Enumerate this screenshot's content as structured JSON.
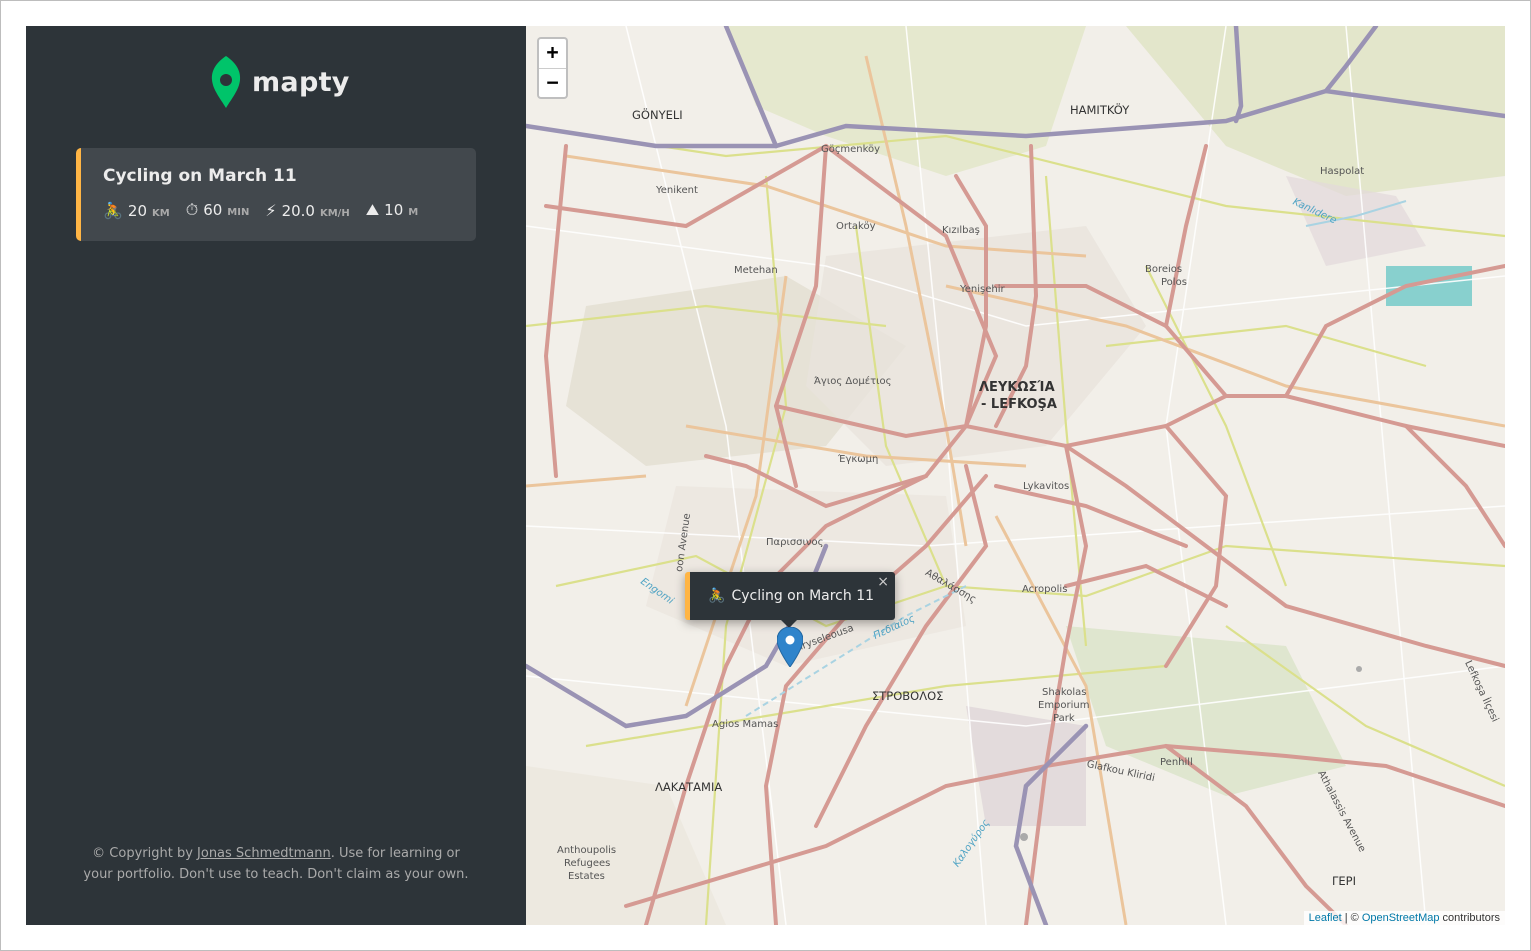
{
  "app": {
    "logo_text": "mapty",
    "copyright": {
      "prefix": "© Copyright by ",
      "author": "Jonas Schmedtmann",
      "suffix": ". Use for learning or your portfolio. Don't use to teach. Don't claim as your own."
    }
  },
  "workout": {
    "title": "Cycling on March 11",
    "type": "cycling",
    "accent": "#ffb545",
    "stats": [
      {
        "icon": "bicycle-icon",
        "glyph": "🚴",
        "value": "20",
        "unit": "km"
      },
      {
        "icon": "stopwatch-icon",
        "glyph": "⏱",
        "value": "60",
        "unit": "min"
      },
      {
        "icon": "lightning-icon",
        "glyph": "⚡",
        "value": "20.0",
        "unit": "km/h"
      },
      {
        "icon": "mountain-icon",
        "glyph": "⛰",
        "value": "10",
        "unit": "m"
      }
    ]
  },
  "map": {
    "zoom_in": "+",
    "zoom_out": "−",
    "popup": {
      "glyph": "🚴",
      "title": "Cycling on March 11",
      "close": "×"
    },
    "attribution": {
      "leaflet": "Leaflet",
      "sep": " | © ",
      "osm": "OpenStreetMap",
      "suffix": " contributors"
    },
    "labels": {
      "gonyeli": "GÖNYELI",
      "hamitkoy": "HAMITKÖY",
      "gocmenkoy": "Göçmenköy",
      "haspolat": "Haspolat",
      "kanlidere": "Kanlıdere",
      "yenikent": "Yenikent",
      "ortakoy": "Ortaköy",
      "kizilbas": "Kızılbaş",
      "metehan": "Metehan",
      "yenisehir": "Yenişehir",
      "boreios": "Boreios",
      "polos": "Polos",
      "agios_dometios": "Άγιος Δομέτιος",
      "lefkosia": "ΛΕΥΚΩΣΊΑ",
      "lefkosa": "- LEFKOŞA",
      "egkomi": "Έγκωμη",
      "lykavitos": "Lykavitos",
      "parisinos": "Παρισσινος",
      "avenue": "oon Avenue",
      "engomi": "Engomi",
      "athalassis": "Αθαλάσσης",
      "acropolis": "Acropolis",
      "chryseleousa": "Chryseleousa",
      "pediaios": "Πεδιαίος",
      "strovolos": "ΣΤΡΟΒΟΛΟΣ",
      "shakolas": "Shakolas",
      "emporium": "Emporium",
      "park": "Park",
      "agios_mamas": "Agios Mamas",
      "glafkou": "Glafkou Kliridi",
      "penhill": "Penhill",
      "lakatamia": "ΛΑΚΑΤΑΜΙΑ",
      "kalogyros": "Καλογύρος",
      "athalassis_ave": "Athalassis Avenue",
      "lefkosa_ilcesi": "Lefkoşa İlçesi",
      "anthoupolis": "Anthoupolis",
      "refugees": "Refugees",
      "estates": "Estates",
      "geri": "ΓΕΡΙ"
    }
  }
}
